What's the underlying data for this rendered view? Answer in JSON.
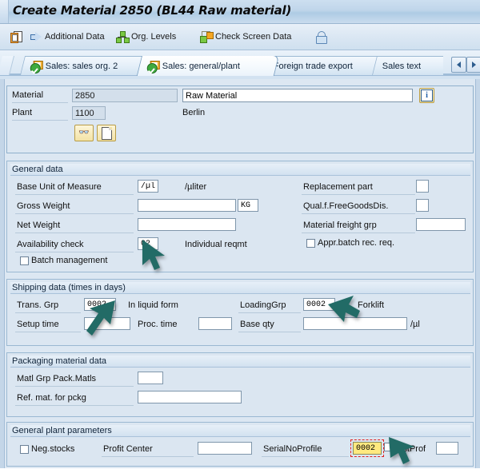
{
  "window": {
    "title": "Create Material 2850 (BL44 Raw material)"
  },
  "toolbar": {
    "items": [
      {
        "label": "",
        "icon": "clipboard-icon"
      },
      {
        "label": "Additional Data",
        "icon": "blue-arrow-icon"
      },
      {
        "label": "Org. Levels",
        "icon": "org-levels-icon"
      },
      {
        "label": "Check Screen Data",
        "icon": "check-screen-icon"
      },
      {
        "label": "",
        "icon": "lock-icon"
      }
    ],
    "clipboard_label": "",
    "additional_data_label": "Additional Data",
    "org_levels_label": "Org. Levels",
    "check_screen_label": "Check Screen Data",
    "lock_label": ""
  },
  "tabs": {
    "items": [
      {
        "label": "Sales: sales org. 2",
        "active": false,
        "icon": "sales-status-icon"
      },
      {
        "label": "Sales: general/plant",
        "active": true,
        "icon": "sales-status-icon"
      },
      {
        "label": "Foreign trade export",
        "active": false,
        "icon": ""
      },
      {
        "label": "Sales text",
        "active": false,
        "icon": ""
      }
    ],
    "nav_prev": "◄",
    "nav_next": "►"
  },
  "header": {
    "material_label": "Material",
    "material_value": "2850",
    "material_desc": "Raw Material",
    "plant_label": "Plant",
    "plant_value": "1100",
    "plant_desc": "Berlin",
    "info_icon": "info-icon",
    "glasses_icon": "display-glasses-icon",
    "page_icon": "page-icon"
  },
  "general_data": {
    "title": "General data",
    "base_uom_label": "Base Unit of Measure",
    "base_uom_value": "/µl",
    "base_uom_desc": "/µliter",
    "gross_weight_label": "Gross Weight",
    "gross_weight_value": "",
    "gross_weight_unit": "KG",
    "net_weight_label": "Net Weight",
    "net_weight_value": "",
    "availability_label": "Availability check",
    "availability_value": "02",
    "availability_desc": "Individual reqmt",
    "batch_mgmt_label": "Batch management",
    "batch_mgmt_checked": false,
    "replacement_label": "Replacement part",
    "replacement_value": "",
    "qual_free_goods_label": "Qual.f.FreeGoodsDis.",
    "qual_free_goods_value": "",
    "freight_grp_label": "Material freight grp",
    "freight_grp_value": "",
    "appr_batch_label": "Appr.batch rec. req.",
    "appr_batch_checked": false
  },
  "shipping_data": {
    "title": "Shipping data (times in days)",
    "trans_grp_label": "Trans. Grp",
    "trans_grp_value": "0002",
    "trans_grp_desc": "In liquid form",
    "loading_grp_label": "LoadingGrp",
    "loading_grp_value": "0002",
    "loading_grp_desc": "Forklift",
    "setup_time_label": "Setup time",
    "setup_time_value": "",
    "proc_time_label": "Proc. time",
    "proc_time_value": "",
    "base_qty_label": "Base qty",
    "base_qty_value": "",
    "base_qty_unit": "/µl"
  },
  "packaging_data": {
    "title": "Packaging material data",
    "matl_grp_label": "Matl Grp Pack.Matls",
    "matl_grp_value": "",
    "ref_mat_label": "Ref. mat. for pckg",
    "ref_mat_value": ""
  },
  "plant_params": {
    "title": "General plant parameters",
    "neg_stocks_label": "Neg.stocks",
    "neg_stocks_checked": false,
    "profit_center_label": "Profit Center",
    "profit_center_value": "",
    "serial_profile_label": "SerialNoProfile",
    "serial_profile_value": "0002",
    "dist_prof_label": "DistProf",
    "dist_prof_checked": false,
    "dist_prof_value": ""
  },
  "colors": {
    "window_bg": "#dce7f2",
    "focus_field": "#ffe97f",
    "focus_ring": "#e02020",
    "cursor": "#226b66",
    "accent": "#2d5d8e"
  }
}
